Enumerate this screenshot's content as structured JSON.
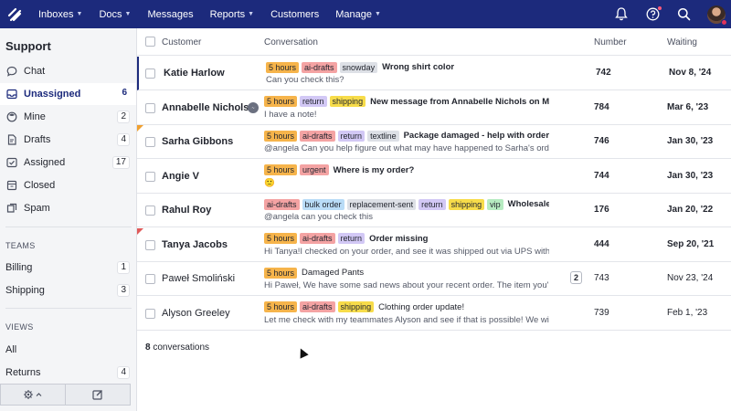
{
  "topnav": {
    "items": [
      {
        "label": "Inboxes",
        "dropdown": true
      },
      {
        "label": "Docs",
        "dropdown": true
      },
      {
        "label": "Messages",
        "dropdown": false
      },
      {
        "label": "Reports",
        "dropdown": true
      },
      {
        "label": "Customers",
        "dropdown": false
      },
      {
        "label": "Manage",
        "dropdown": true
      }
    ],
    "bg_color": "#1c2a7c"
  },
  "sidebar": {
    "title": "Support",
    "items": [
      {
        "label": "Chat",
        "count": "",
        "icon": "chat-bubble-icon"
      },
      {
        "label": "Unassigned",
        "count": "6",
        "icon": "inbox-icon",
        "active": true
      },
      {
        "label": "Mine",
        "count": "2",
        "icon": "user-icon"
      },
      {
        "label": "Drafts",
        "count": "4",
        "icon": "draft-icon"
      },
      {
        "label": "Assigned",
        "count": "17",
        "icon": "assigned-check-icon"
      },
      {
        "label": "Closed",
        "count": "",
        "icon": "closed-archive-icon"
      },
      {
        "label": "Spam",
        "count": "",
        "icon": "spam-icon"
      }
    ],
    "teams_heading": "TEAMS",
    "teams": [
      {
        "label": "Billing",
        "count": "1"
      },
      {
        "label": "Shipping",
        "count": "3"
      }
    ],
    "views_heading": "VIEWS",
    "views": [
      {
        "label": "All",
        "count": ""
      },
      {
        "label": "Returns",
        "count": "4"
      }
    ]
  },
  "table": {
    "headers": {
      "customer": "Customer",
      "conversation": "Conversation",
      "number": "Number",
      "waiting": "Waiting"
    },
    "rows": [
      {
        "customer": "Katie Harlow",
        "tags": [
          {
            "label": "5 hours",
            "color": "orange"
          },
          {
            "label": "ai-drafts",
            "color": "red"
          },
          {
            "label": "snowday",
            "color": "gray"
          }
        ],
        "subject": "Wrong shirt color",
        "preview": "Can you check this?",
        "number": "742",
        "waiting": "Nov 8, '24",
        "unread": true,
        "selected": true
      },
      {
        "customer": "Annabelle Nichols",
        "messenger": true,
        "tags": [
          {
            "label": "5 hours",
            "color": "orange"
          },
          {
            "label": "return",
            "color": "purple"
          },
          {
            "label": "shipping",
            "color": "yellow"
          }
        ],
        "subject": "New message from Annabelle Nichols on Messenger",
        "preview": "I have a note!",
        "number": "784",
        "waiting": "Mar 6, '23",
        "unread": true
      },
      {
        "customer": "Sarha Gibbons",
        "flag": "orange",
        "tags": [
          {
            "label": "5 hours",
            "color": "orange"
          },
          {
            "label": "ai-drafts",
            "color": "red"
          },
          {
            "label": "return",
            "color": "purple"
          },
          {
            "label": "textline",
            "color": "gray"
          }
        ],
        "subject": "Package damaged - help with order",
        "preview": "@angela Can you help figure out what may have happened to Sarha's order?",
        "number": "746",
        "waiting": "Jan 30, '23",
        "unread": true
      },
      {
        "customer": "Angie V",
        "tags": [
          {
            "label": "5 hours",
            "color": "orange"
          },
          {
            "label": "urgent",
            "color": "red"
          }
        ],
        "subject": "Where is my order?",
        "preview": "🙁",
        "number": "744",
        "waiting": "Jan 30, '23",
        "unread": true
      },
      {
        "customer": "Rahul Roy",
        "tags": [
          {
            "label": "ai-drafts",
            "color": "red"
          },
          {
            "label": "bulk order",
            "color": "blue"
          },
          {
            "label": "replacement-sent",
            "color": "gray"
          },
          {
            "label": "return",
            "color": "purple"
          },
          {
            "label": "shipping",
            "color": "yellow"
          },
          {
            "label": "vip",
            "color": "green"
          }
        ],
        "subject": "Wholesale se",
        "preview": "@angela can you check this",
        "number": "176",
        "waiting": "Jan 20, '22",
        "unread": true
      },
      {
        "customer": "Tanya Jacobs",
        "flag": "red",
        "tags": [
          {
            "label": "5 hours",
            "color": "orange"
          },
          {
            "label": "ai-drafts",
            "color": "red"
          },
          {
            "label": "return",
            "color": "purple"
          }
        ],
        "subject": "Order missing",
        "preview": "Hi Tanya!I checked on your order, and see it was shipped out via UPS with the tracking",
        "number": "444",
        "waiting": "Sep 20, '21",
        "unread": true
      },
      {
        "customer": "Paweł Smoliński",
        "tags": [
          {
            "label": "5 hours",
            "color": "orange"
          }
        ],
        "subject": "Damaged Pants",
        "preview": "Hi Paweł, We have some sad news about your recent order. The item you're intereste",
        "number": "743",
        "waiting": "Nov 23, '24",
        "unread": false,
        "reply_count": "2"
      },
      {
        "customer": "Alyson Greeley",
        "tags": [
          {
            "label": "5 hours",
            "color": "orange"
          },
          {
            "label": "ai-drafts",
            "color": "red"
          },
          {
            "label": "shipping",
            "color": "yellow"
          }
        ],
        "subject": "Clothing order update!",
        "preview": "Let me check with my teammates Alyson and see if that is possible! We will be back",
        "number": "739",
        "waiting": "Feb 1, '23",
        "unread": false
      }
    ],
    "footer_count": "8",
    "footer_label": "conversations"
  }
}
